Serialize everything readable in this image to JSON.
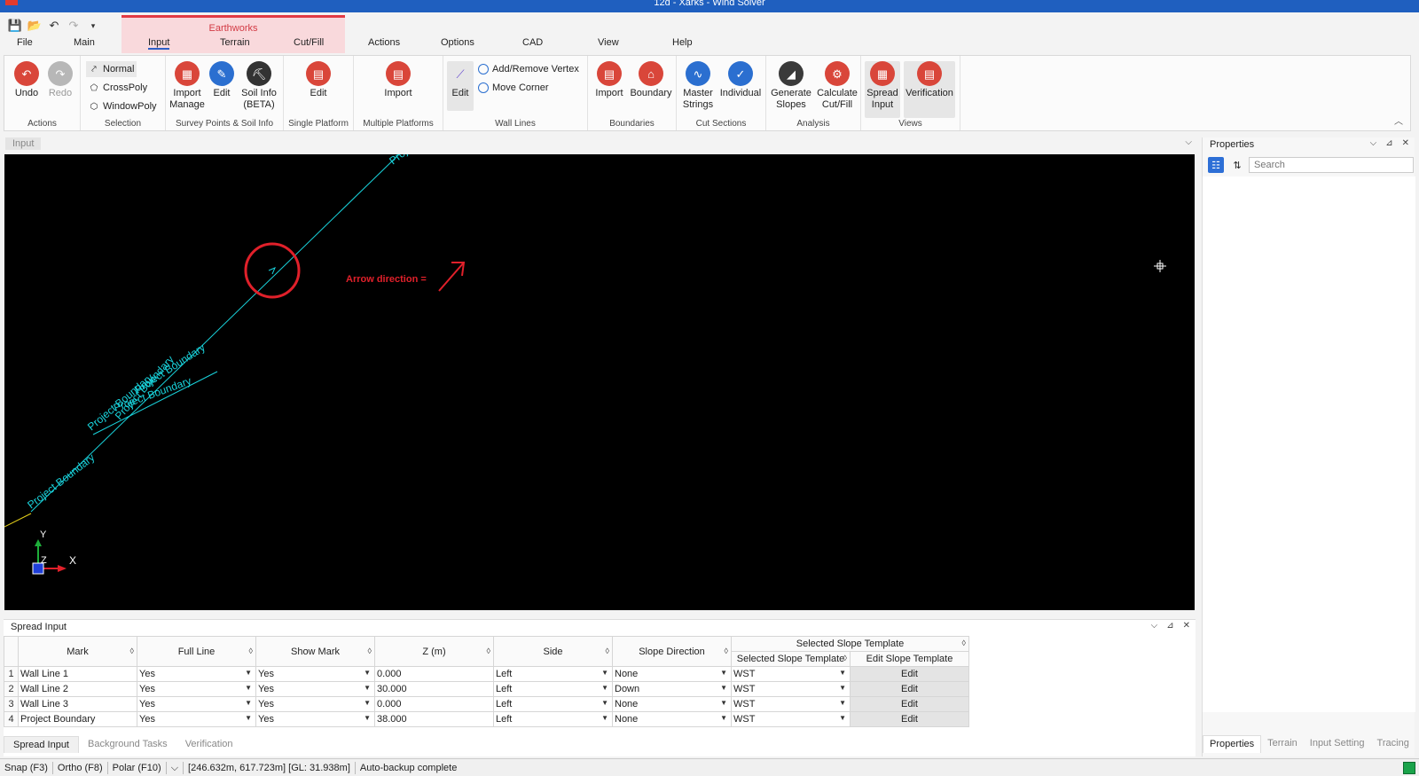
{
  "window": {
    "title": "12d - Xarks - Wind Solver"
  },
  "quick_access": {
    "icons": [
      "save-icon",
      "open-icon",
      "undo-icon",
      "redo-icon",
      "customize-icon"
    ]
  },
  "contextual": {
    "label": "Earthworks"
  },
  "tabs": [
    "File",
    "Main",
    "Input",
    "Terrain",
    "Cut/Fill",
    "Actions",
    "Options",
    "CAD",
    "View",
    "Help"
  ],
  "ribbon": {
    "actions": {
      "label": "Actions",
      "undo": "Undo",
      "redo": "Redo"
    },
    "selection": {
      "label": "Selection",
      "normal": "Normal",
      "crosspoly": "CrossPoly",
      "windowpoly": "WindowPoly"
    },
    "survey": {
      "label": "Survey Points & Soil Info",
      "import": "Import",
      "import2": "Manage",
      "edit": "Edit",
      "soil": "Soil Info",
      "soil2": "(BETA)"
    },
    "single": {
      "label": "Single Platform",
      "edit": "Edit"
    },
    "multiple": {
      "label": "Multiple Platforms",
      "import": "Import"
    },
    "wall": {
      "label": "Wall Lines",
      "edit": "Edit",
      "addremove": "Add/Remove Vertex",
      "move": "Move Corner"
    },
    "boundaries": {
      "label": "Boundaries",
      "import": "Import",
      "boundary": "Boundary"
    },
    "cut": {
      "label": "Cut Sections",
      "master": "Master",
      "master2": "Strings",
      "individual": "Individual"
    },
    "analysis": {
      "label": "Analysis",
      "generate": "Generate",
      "generate2": "Slopes",
      "calc": "Calculate",
      "calc2": "Cut/Fill"
    },
    "views": {
      "label": "Views",
      "spread": "Spread",
      "spread2": "Input",
      "verification": "Verification"
    }
  },
  "input_pane": {
    "tab": "Input"
  },
  "canvas": {
    "annotation": "Arrow direction =",
    "labels": [
      "Project Boundary",
      "Project Boundary",
      "Project Boundary",
      "Project Boundary",
      "Project Boundary",
      "Project Boundary"
    ],
    "axis": {
      "x": "X",
      "y": "Y",
      "z": "Z"
    }
  },
  "properties": {
    "title": "Properties",
    "search_placeholder": "Search",
    "tabs": [
      "Properties",
      "Terrain",
      "Input Setting",
      "Tracing"
    ]
  },
  "spread": {
    "title": "Spread Input",
    "group_header": "Selected Slope Template",
    "columns": [
      "Mark",
      "Full Line",
      "Show Mark",
      "Z (m)",
      "Side",
      "Slope Direction",
      "Selected Slope Template",
      "Edit Slope Template"
    ],
    "rows": [
      {
        "n": "1",
        "mark": "Wall Line 1",
        "full": "Yes",
        "show": "Yes",
        "z": "0.000",
        "side": "Left",
        "dir": "None",
        "tpl": "WST",
        "edit": "Edit"
      },
      {
        "n": "2",
        "mark": "Wall Line 2",
        "full": "Yes",
        "show": "Yes",
        "z": "30.000",
        "side": "Left",
        "dir": "Down",
        "tpl": "WST",
        "edit": "Edit"
      },
      {
        "n": "3",
        "mark": "Wall Line 3",
        "full": "Yes",
        "show": "Yes",
        "z": "0.000",
        "side": "Left",
        "dir": "None",
        "tpl": "WST",
        "edit": "Edit"
      },
      {
        "n": "4",
        "mark": "Project Boundary",
        "full": "Yes",
        "show": "Yes",
        "z": "38.000",
        "side": "Left",
        "dir": "None",
        "tpl": "WST",
        "edit": "Edit"
      }
    ],
    "bottom_tabs": [
      "Spread Input",
      "Background Tasks",
      "Verification"
    ]
  },
  "status": {
    "snap": "Snap (F3)",
    "ortho": "Ortho (F8)",
    "polar": "Polar (F10)",
    "coords": "[246.632m, 617.723m] [GL: 31.938m]",
    "message": "Auto-backup complete"
  },
  "colors": {
    "accent": "#2d5fc6",
    "contextual": "#e23b45",
    "cyan": "#19d3dc",
    "red": "#e0202a"
  }
}
